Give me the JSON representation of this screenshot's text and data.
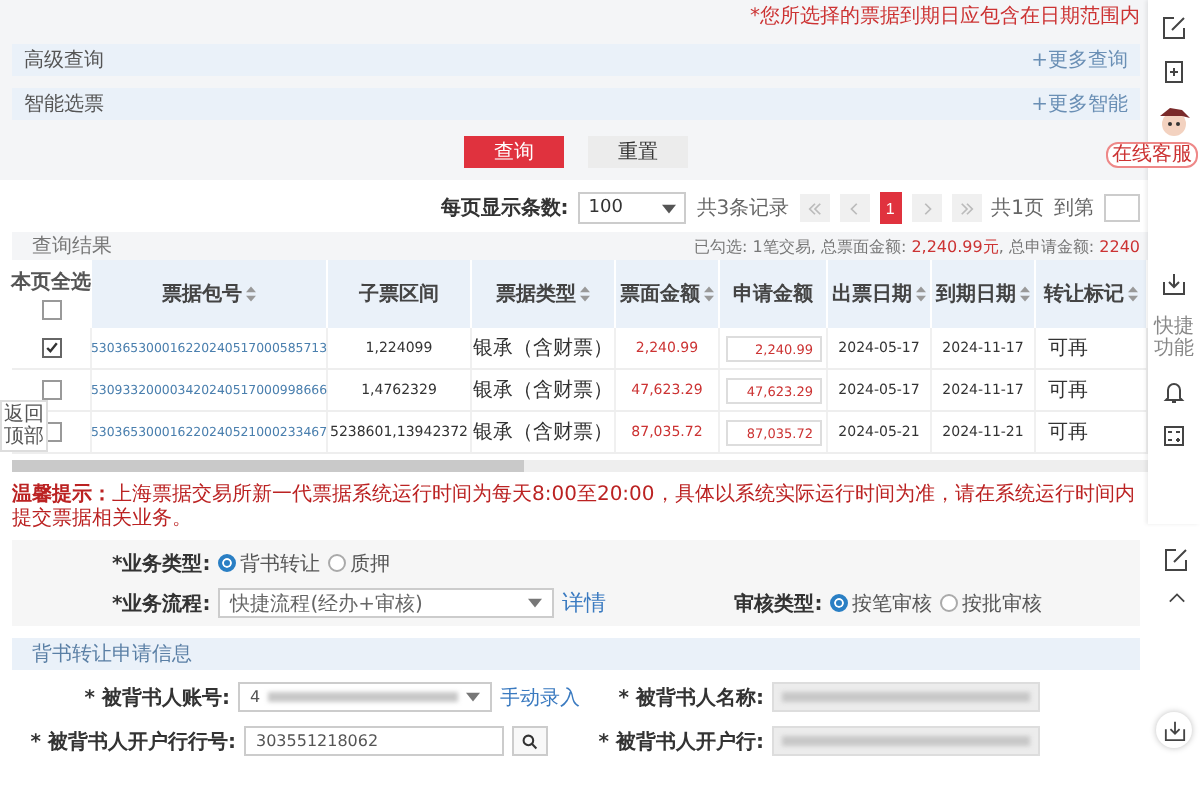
{
  "notice": "*您所选择的票据到期日应包含在日期范围内",
  "query_panels": [
    {
      "label": "高级查询",
      "more": "+更多查询"
    },
    {
      "label": "智能选票",
      "more": "+更多智能"
    }
  ],
  "buttons": [
    {
      "label": "查询",
      "kind": "primary"
    },
    {
      "label": "重置",
      "kind": "default"
    }
  ],
  "pagination": {
    "page_size_label": "每页显示条数:",
    "page_size": "100",
    "total": "共3条记录",
    "pages": [
      {
        "label": "1",
        "selected": true
      }
    ],
    "page_count": "共1页",
    "goto_label": "到第"
  },
  "results": {
    "title": "查询结果",
    "summary": [
      {
        "text": "已勾选: 1笔交易, 总票面金额: ",
        "highlight": false
      },
      {
        "text": "2,240.99元",
        "highlight": true
      },
      {
        "text": ", 总申请金额: ",
        "highlight": false
      },
      {
        "text": "2240",
        "highlight": true
      }
    ],
    "select_all_label": "本页全选",
    "select_all_checked": false,
    "columns": [
      {
        "label": "票据包号",
        "sortable": true
      },
      {
        "label": "子票区间",
        "sortable": false
      },
      {
        "label": "票据类型",
        "sortable": true
      },
      {
        "label": "票面金额",
        "sortable": true
      },
      {
        "label": "申请金额",
        "sortable": false
      },
      {
        "label": "出票日期",
        "sortable": true
      },
      {
        "label": "到期日期",
        "sortable": true
      },
      {
        "label": "转让标记",
        "sortable": true
      }
    ],
    "rows": [
      {
        "checked": true,
        "package_no": "530365300016220240517000585713",
        "sub_range": "1,224099",
        "type": "银承（含财票）",
        "face_amount": "2,240.99",
        "apply_amount": "2,240.99",
        "issue_date": "2024-05-17",
        "due_date": "2024-11-17",
        "transfer_mark": "可再"
      },
      {
        "checked": false,
        "package_no": "530933200003420240517000998666",
        "sub_range": "1,4762329",
        "type": "银承（含财票）",
        "face_amount": "47,623.29",
        "apply_amount": "47,623.29",
        "issue_date": "2024-05-17",
        "due_date": "2024-11-17",
        "transfer_mark": "可再"
      },
      {
        "checked": false,
        "package_no": "530365300016220240521000233467",
        "sub_range": "5238601,13942372",
        "type": "银承（含财票）",
        "face_amount": "87,035.72",
        "apply_amount": "87,035.72",
        "issue_date": "2024-05-21",
        "due_date": "2024-11-21",
        "transfer_mark": "可再"
      }
    ]
  },
  "warning": {
    "label": "温馨提示：",
    "text": "上海票据交易所新一代票据系统运行时间为每天8:00至20:00，具体以系统实际运行时间为准，请在系统运行时间内提交票据相关业务。"
  },
  "business_type": {
    "label": "*业务类型:",
    "options": [
      {
        "label": "背书转让",
        "selected": true
      },
      {
        "label": "质押",
        "selected": false
      }
    ]
  },
  "process": {
    "label": "*业务流程:",
    "value": "快捷流程(经办+审核)",
    "link": "详情"
  },
  "review_type": {
    "label": "审核类型:",
    "options": [
      {
        "label": "按笔审核",
        "selected": true
      },
      {
        "label": "按批审核",
        "selected": false
      }
    ]
  },
  "section_title": "背书转让申请信息",
  "fields": [
    {
      "label": "* 被背书人账号:",
      "kind": "select",
      "value": "4",
      "redacted": true,
      "link": "手动录入"
    },
    {
      "label": "* 被背书人名称:",
      "kind": "readonly",
      "redacted": true
    },
    {
      "label": "* 被背书人开户行行号:",
      "kind": "search",
      "value": "303551218062",
      "redacted": false
    },
    {
      "label": "* 被背书人开户行:",
      "kind": "readonly",
      "redacted": true
    }
  ],
  "sidebar": {
    "service_label": "在线客服",
    "quick_label": "快捷功能"
  },
  "back_to_top": "返回顶部"
}
